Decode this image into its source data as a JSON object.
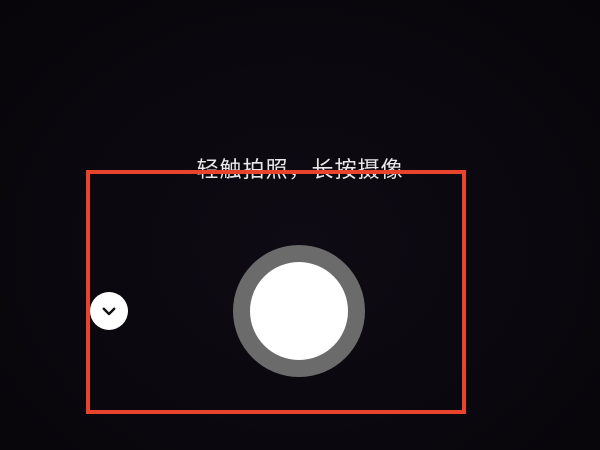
{
  "camera": {
    "hint": "轻触拍照，长按摄像",
    "shutter_icon": "shutter-button",
    "collapse_icon": "chevron-down-icon"
  },
  "colors": {
    "background": "#0b0810",
    "highlight": "#e8432c",
    "shutter_ring": "#6b6b6b",
    "shutter_core": "#ffffff"
  }
}
